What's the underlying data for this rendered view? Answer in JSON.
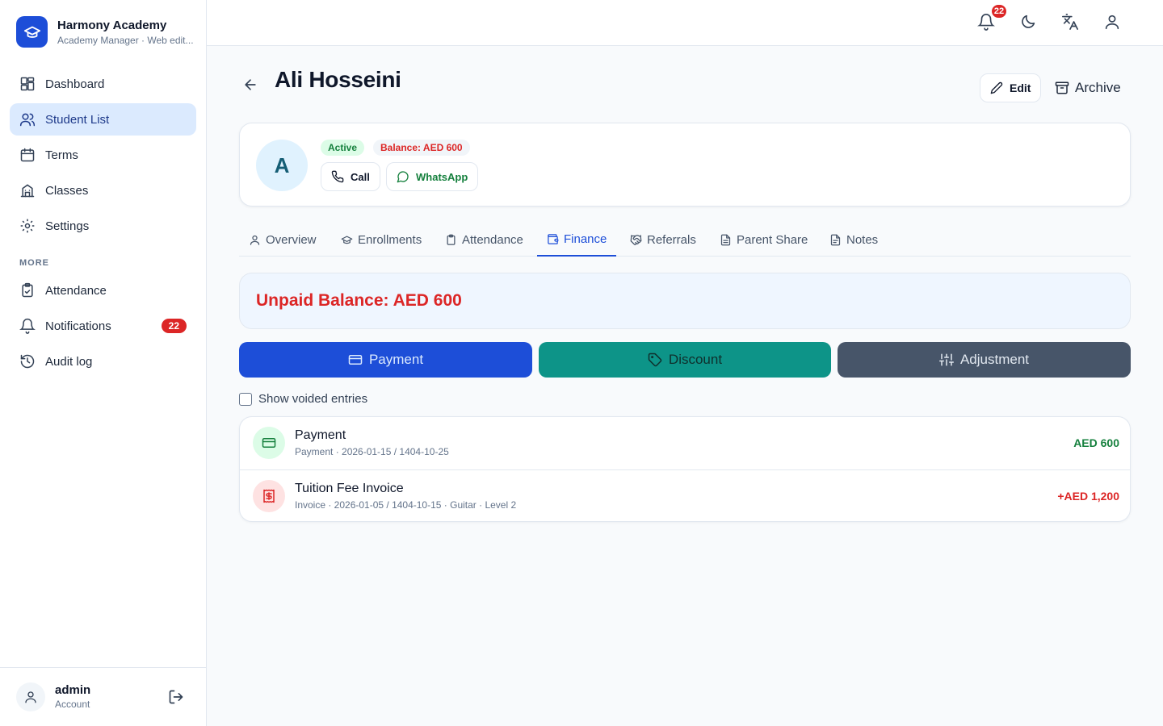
{
  "app": {
    "name": "Harmony Academy",
    "subtitle": "Academy Manager · Web edit..."
  },
  "sidebar": {
    "items": [
      {
        "label": "Dashboard",
        "icon": "dashboard-icon"
      },
      {
        "label": "Student List",
        "icon": "users-icon",
        "active": true
      },
      {
        "label": "Terms",
        "icon": "calendar-icon"
      },
      {
        "label": "Classes",
        "icon": "building-icon"
      },
      {
        "label": "Settings",
        "icon": "gear-icon"
      }
    ],
    "more_label": "MORE",
    "more_items": [
      {
        "label": "Attendance",
        "icon": "clipboard-icon"
      },
      {
        "label": "Notifications",
        "icon": "bell-icon",
        "badge": "22"
      },
      {
        "label": "Audit log",
        "icon": "history-icon"
      }
    ]
  },
  "user": {
    "name": "admin",
    "role": "Account"
  },
  "topbar": {
    "notification_count": "22"
  },
  "student": {
    "name": "Ali Hosseini",
    "initial": "A",
    "status": "Active",
    "balance_badge": "Balance: AED 600",
    "call_label": "Call",
    "whatsapp_label": "WhatsApp"
  },
  "header_actions": {
    "edit_label": "Edit",
    "archive_label": "Archive"
  },
  "tabs": [
    {
      "label": "Overview",
      "icon": "user-icon"
    },
    {
      "label": "Enrollments",
      "icon": "graduation-cap-icon"
    },
    {
      "label": "Attendance",
      "icon": "clipboard-icon"
    },
    {
      "label": "Finance",
      "icon": "wallet-icon",
      "active": true
    },
    {
      "label": "Referrals",
      "icon": "handshake-icon"
    },
    {
      "label": "Parent Share",
      "icon": "document-icon"
    },
    {
      "label": "Notes",
      "icon": "notes-icon"
    }
  ],
  "finance": {
    "unpaid_text": "Unpaid Balance: AED 600",
    "actions": {
      "payment": "Payment",
      "discount": "Discount",
      "adjustment": "Adjustment"
    },
    "show_voided_label": "Show voided entries",
    "show_voided_checked": false,
    "entries": [
      {
        "title": "Payment",
        "sub": "Payment · 2026-01-15 / 1404-10-25",
        "amount": "AED 600",
        "tone": "green",
        "icon": "credit-card-icon"
      },
      {
        "title": "Tuition Fee Invoice",
        "sub": "Invoice · 2026-01-05 / 1404-10-15 · Guitar · Level 2",
        "amount": "+AED 1,200",
        "tone": "red",
        "icon": "invoice-icon"
      }
    ]
  },
  "colors": {
    "primary": "#1d4ed8",
    "discount": "#0d9488",
    "adjustment": "#475569",
    "danger": "#dc2626",
    "success": "#15803d"
  }
}
